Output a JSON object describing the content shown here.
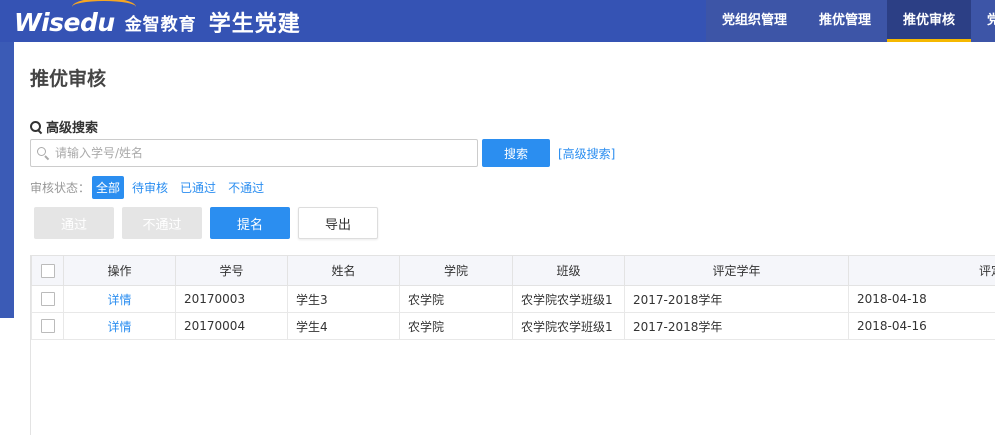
{
  "brand": {
    "logo": "Wisedu",
    "cn_name": "金智教育",
    "app_title": "学生党建"
  },
  "nav": [
    {
      "label": "党组织管理",
      "active": false
    },
    {
      "label": "推优管理",
      "active": false
    },
    {
      "label": "推优审核",
      "active": true
    },
    {
      "label": "党",
      "active": false
    }
  ],
  "page": {
    "title": "推优审核"
  },
  "search": {
    "section_title": "高级搜索",
    "placeholder": "请输入学号/姓名",
    "button": "搜索",
    "advanced_link": "[高级搜索]"
  },
  "filter": {
    "label": "审核状态：",
    "options": [
      "全部",
      "待审核",
      "已通过",
      "不通过"
    ],
    "selected": "全部"
  },
  "actions": {
    "approve": "通过",
    "reject": "不通过",
    "nominate": "提名",
    "export": "导出"
  },
  "table": {
    "headers": [
      "",
      "操作",
      "学号",
      "姓名",
      "学院",
      "班级",
      "评定学年",
      "评定日期"
    ],
    "rows": [
      {
        "action": "详情",
        "id": "20170003",
        "name": "学生3",
        "college": "农学院",
        "class": "农学院农学班级1",
        "year": "2017-2018学年",
        "date": "2018-04-18"
      },
      {
        "action": "详情",
        "id": "20170004",
        "name": "学生4",
        "college": "农学院",
        "class": "农学院农学班级1",
        "year": "2017-2018学年",
        "date": "2018-04-16"
      }
    ]
  },
  "colors": {
    "header_bg": "#3553b4",
    "accent": "#2b8ef0",
    "nav_active_underline": "#f5b800"
  }
}
